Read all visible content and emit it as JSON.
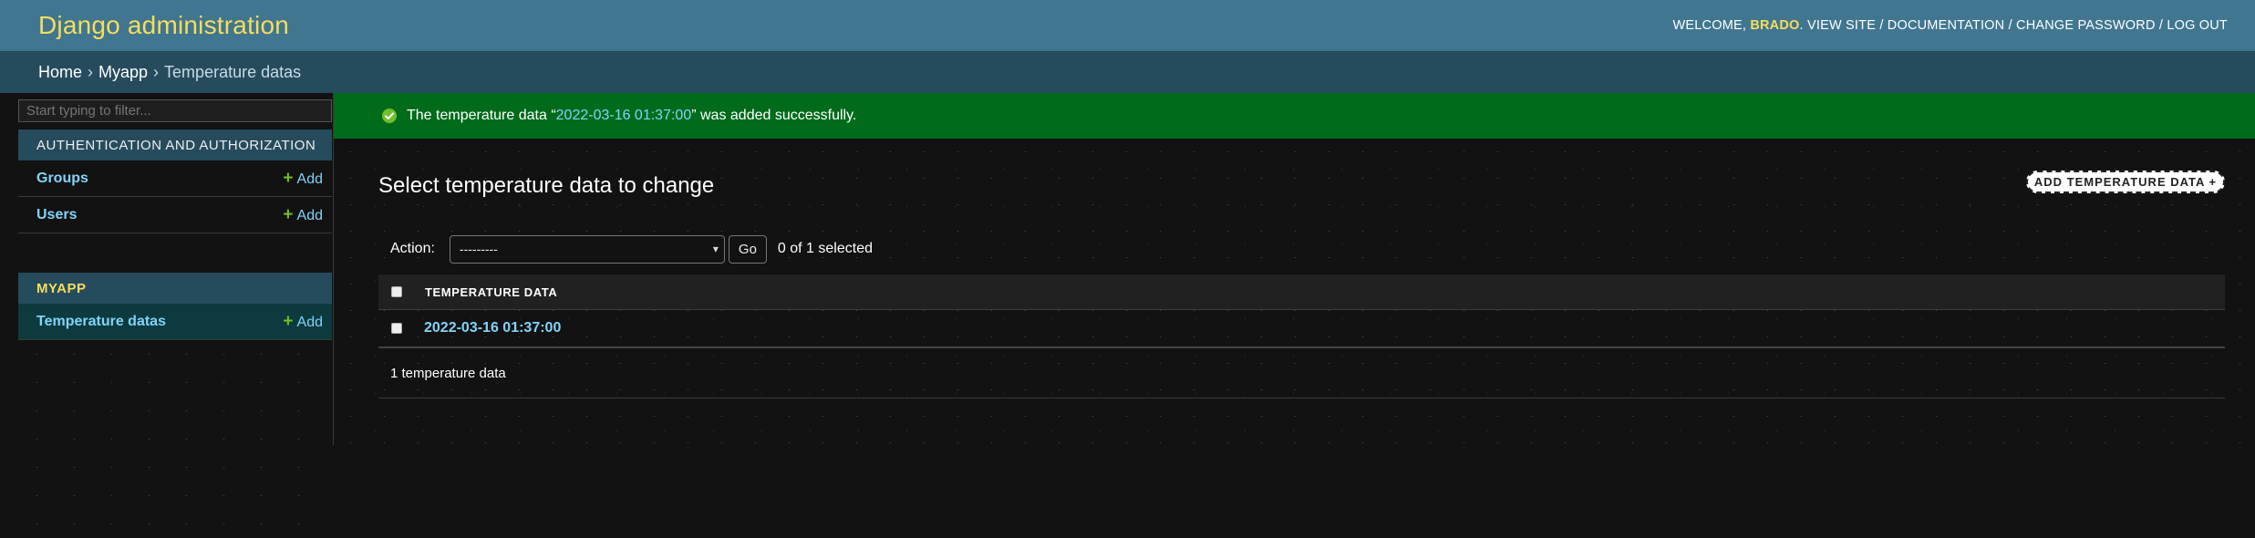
{
  "header": {
    "site_name": "Django administration",
    "welcome": "WELCOME,",
    "username": "BRADO",
    "links": [
      "VIEW SITE",
      "DOCUMENTATION",
      "CHANGE PASSWORD",
      "LOG OUT"
    ]
  },
  "breadcrumbs": [
    "Home",
    "Myapp",
    "Temperature datas"
  ],
  "sidebar": {
    "filter_placeholder": "Start typing to filter...",
    "apps": [
      {
        "caption": "AUTHENTICATION AND AUTHORIZATION",
        "models": [
          {
            "name": "Groups",
            "add": "Add"
          },
          {
            "name": "Users",
            "add": "Add"
          }
        ]
      },
      {
        "caption": "MYAPP",
        "models": [
          {
            "name": "Temperature datas",
            "add": "Add"
          }
        ]
      }
    ]
  },
  "message": {
    "prefix": "The temperature data “",
    "link": "2022-03-16 01:37:00",
    "suffix": "” was added successfully."
  },
  "content": {
    "title": "Select temperature data to change",
    "add_button": "ADD TEMPERATURE DATA +",
    "action_label": "Action:",
    "action_selected": "---------",
    "go_label": "Go",
    "counter": "0 of 1 selected",
    "column_header": "TEMPERATURE DATA",
    "rows": [
      "2022-03-16 01:37:00"
    ],
    "paginator": "1 temperature data"
  },
  "colors": {
    "header_bg": "#417690",
    "breadcrumbs_bg": "#264b5d",
    "site_name": "#f5dd5d",
    "link": "#81d4fa",
    "success_bg": "#006b1b",
    "add_plus": "#70bf2b"
  }
}
